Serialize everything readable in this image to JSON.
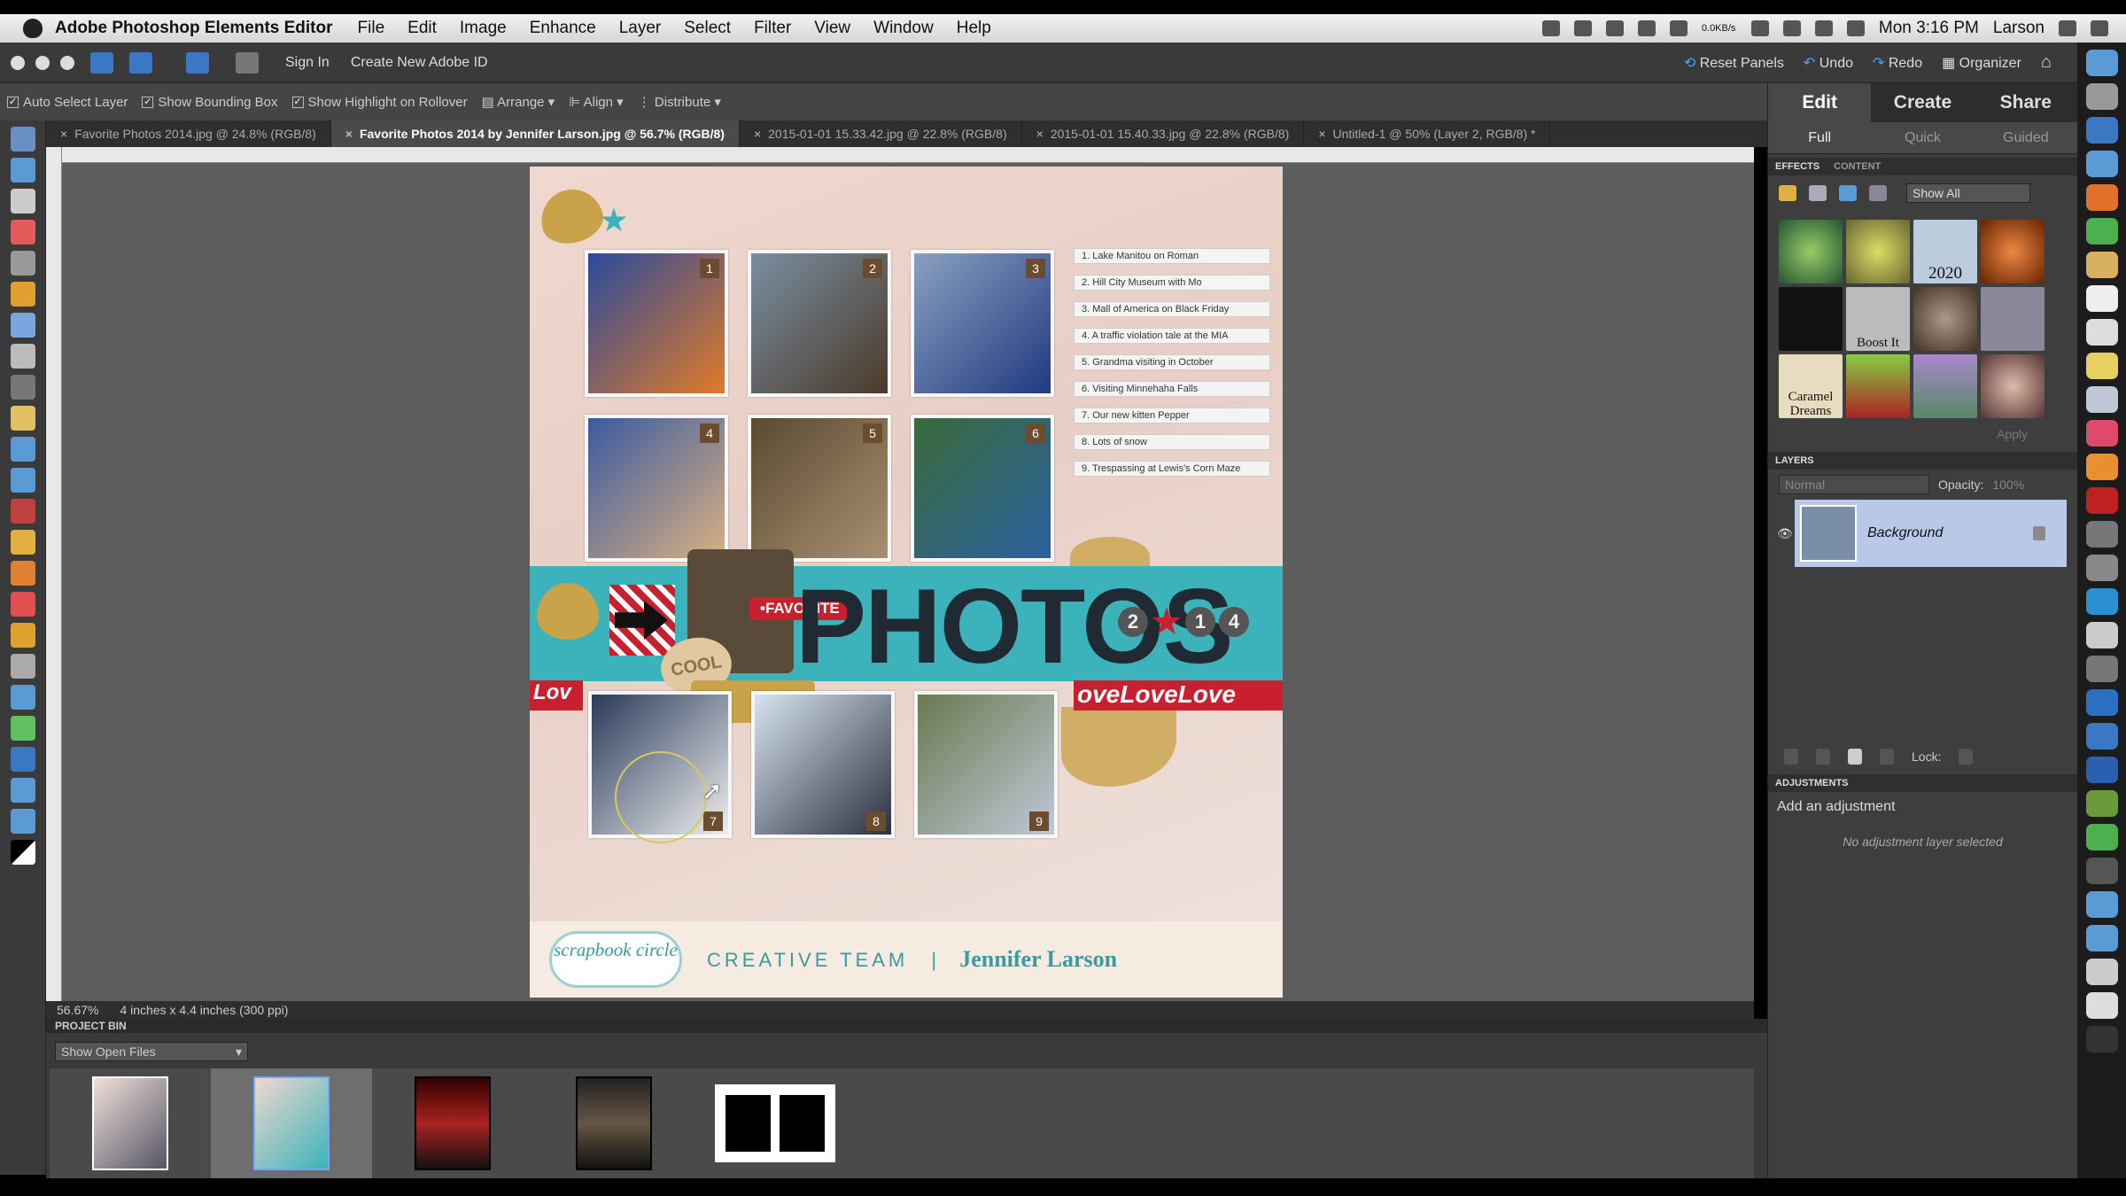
{
  "menubar": {
    "app_name": "Adobe Photoshop Elements Editor",
    "menus": [
      "File",
      "Edit",
      "Image",
      "Enhance",
      "Layer",
      "Select",
      "Filter",
      "View",
      "Window",
      "Help"
    ],
    "net_speed": "0.0KB/s",
    "clock": "Mon 3:16 PM",
    "user": "Larson"
  },
  "toolbar": {
    "sign_in": "Sign In",
    "create_id": "Create New Adobe ID",
    "reset_panels": "Reset Panels",
    "undo": "Undo",
    "redo": "Redo",
    "organizer": "Organizer"
  },
  "options": {
    "auto_select": "Auto Select Layer",
    "show_bounding": "Show Bounding Box",
    "show_highlight": "Show Highlight on Rollover",
    "arrange": "Arrange",
    "align": "Align",
    "distribute": "Distribute"
  },
  "tabs": [
    "Favorite Photos 2014.jpg @ 24.8% (RGB/8)",
    "Favorite Photos 2014 by Jennifer Larson.jpg @ 56.7% (RGB/8)",
    "2015-01-01 15.33.42.jpg @ 22.8% (RGB/8)",
    "2015-01-01 15.40.33.jpg @ 22.8% (RGB/8)",
    "Untitled-1 @ 50% (Layer 2, RGB/8) *"
  ],
  "document": {
    "title_word": "PHOTOS",
    "favorite_tag": "•FAVORITE",
    "cool_tag": "COOL",
    "year_digits": [
      "2",
      "1",
      "4"
    ],
    "love_left": "Lov",
    "love_right": "oveLoveLove",
    "photo_numbers": [
      "1",
      "2",
      "3",
      "4",
      "5",
      "6",
      "7",
      "8",
      "9"
    ],
    "journal": [
      "1. Lake Manitou on Roman",
      "2. Hill City Museum with Mo",
      "3. Mall of America on Black Friday",
      "4. A traffic violation tale at the MIA",
      "5. Grandma visiting in October",
      "6. Visiting Minnehaha Falls",
      "7. Our new kitten Pepper",
      "8. Lots of snow",
      "9. Trespassing at Lewis's Corn Maze"
    ],
    "footer_badge": "scrapbook circle",
    "footer_team": "CREATIVE TEAM",
    "footer_sep": "|",
    "footer_name": "Jennifer Larson"
  },
  "status": {
    "zoom": "56.67%",
    "size": "4 inches x 4.4 inches (300 ppi)"
  },
  "project_bin": {
    "header": "PROJECT BIN",
    "dropdown": "Show Open Files"
  },
  "right_panel": {
    "modes": [
      "Edit",
      "Create",
      "Share"
    ],
    "submodes": [
      "Full",
      "Quick",
      "Guided"
    ],
    "effects_tab": "EFFECTS",
    "content_tab": "CONTENT",
    "show_all": "Show All",
    "fx_labels": [
      "",
      "",
      "2020",
      "",
      "",
      "Boost It",
      "",
      "",
      "Caramel Dreams",
      "",
      "",
      ""
    ],
    "apply": "Apply",
    "layers_header": "LAYERS",
    "blend_mode": "Normal",
    "opacity_label": "Opacity:",
    "opacity_value": "100%",
    "layer_name": "Background",
    "lock_label": "Lock:",
    "adjustments_header": "ADJUSTMENTS",
    "add_adjustment": "Add an adjustment",
    "no_adjustment": "No adjustment layer selected"
  },
  "colors": {
    "accent_teal": "#3cb3ba",
    "love_red": "#c8202e",
    "layer_selected": "#b8c9e8"
  }
}
